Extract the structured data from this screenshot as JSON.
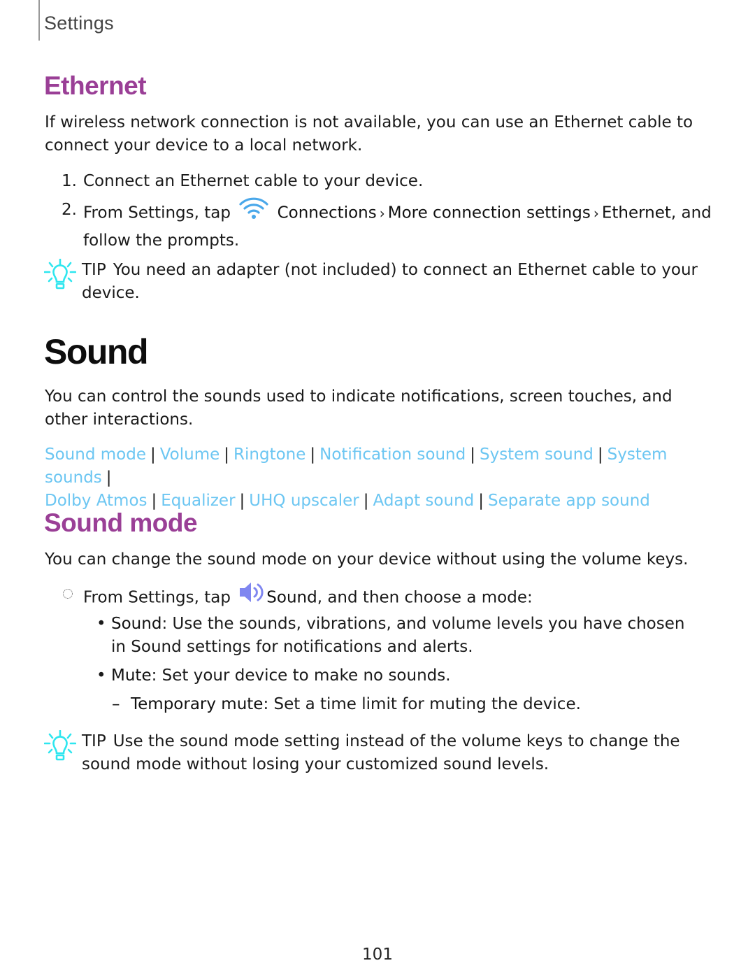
{
  "header": {
    "section": "Settings"
  },
  "ethernet": {
    "title": "Ethernet",
    "intro": "If wireless network connection is not available, you can use an Ethernet cable to connect your device to a local network.",
    "steps": [
      {
        "num": "1.",
        "text": "Connect an Ethernet cable to your device."
      },
      {
        "num": "2.",
        "prefix": "From Settings, tap",
        "icon": "wifi-icon",
        "path": [
          "Connections",
          "More connection settings",
          "Ethernet"
        ],
        "suffix": ", and follow the prompts."
      }
    ],
    "tip": {
      "label": "TIP",
      "text": "You need an adapter (not included) to connect an Ethernet cable to your device."
    }
  },
  "sound": {
    "title": "Sound",
    "intro": "You can control the sounds used to indicate notifications, screen touches, and other interactions.",
    "links": [
      "Sound mode",
      "Volume",
      "Ringtone",
      "Notification sound",
      "System sound",
      "System sounds",
      "Dolby Atmos",
      "Equalizer",
      "UHQ upscaler",
      "Adapt sound",
      "Separate app sound"
    ],
    "separator": "|"
  },
  "sound_mode": {
    "title": "Sound mode",
    "intro": "You can change the sound mode on your device without using the volume keys.",
    "step": {
      "prefix": "From Settings, tap",
      "icon": "speaker-icon",
      "bold": "Sound",
      "suffix": ", and then choose a mode:"
    },
    "options": [
      {
        "term": "Sound",
        "desc": ": Use the sounds, vibrations, and volume levels you have chosen in Sound settings for notifications and alerts."
      },
      {
        "term": "Mute",
        "desc": ": Set your device to make no sounds."
      }
    ],
    "sub_option": {
      "term": "Temporary mute",
      "desc": ": Set a time limit for muting the device."
    },
    "tip": {
      "label": "TIP",
      "text": "Use the sound mode setting instead of the volume keys to change the sound mode without losing your customized sound levels."
    }
  },
  "colors": {
    "heading_accent": "#9a3f96",
    "link": "#6cc6f2",
    "tip_icon": "#2ee6ef",
    "wifi_icon": "#4aa8ea",
    "speaker_icon": "#7f86f0"
  },
  "footer": {
    "page_number": "101"
  }
}
